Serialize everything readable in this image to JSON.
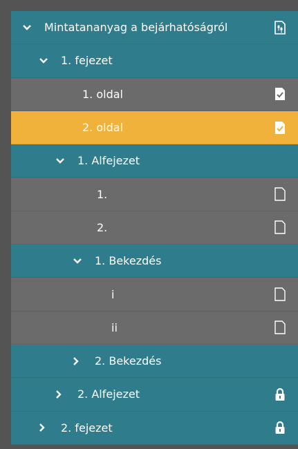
{
  "tree": {
    "rows": [
      {
        "label": "Mintatananyag a bejárhatóságról",
        "icon": "footprints-document-icon",
        "expanded": true
      },
      {
        "label": "1. fejezet",
        "expanded": true
      },
      {
        "label": "1. oldal",
        "icon": "document-check-icon",
        "status": "completed"
      },
      {
        "label": "2. oldal",
        "icon": "document-check-icon",
        "status": "completed",
        "selected": true
      },
      {
        "label": "1. Alfejezet",
        "expanded": true
      },
      {
        "label": "1.",
        "icon": "document-outline-icon",
        "status": "not-visited"
      },
      {
        "label": "2.",
        "icon": "document-outline-icon",
        "status": "not-visited"
      },
      {
        "label": "1. Bekezdés",
        "expanded": true
      },
      {
        "label": "i",
        "icon": "document-outline-icon",
        "status": "not-visited"
      },
      {
        "label": "ii",
        "icon": "document-outline-icon",
        "status": "not-visited"
      },
      {
        "label": "2. Bekezdés",
        "expanded": false
      },
      {
        "label": "2. Alfejezet",
        "expanded": false,
        "icon": "lock-icon",
        "status": "locked"
      },
      {
        "label": "2. fejezet",
        "expanded": false,
        "icon": "lock-icon",
        "status": "locked"
      }
    ]
  },
  "colors": {
    "frame": "#545454",
    "section": "#2f7c8d",
    "page": "#6b6b6b",
    "selected": "#f0b23a",
    "text": "#ffffff"
  }
}
